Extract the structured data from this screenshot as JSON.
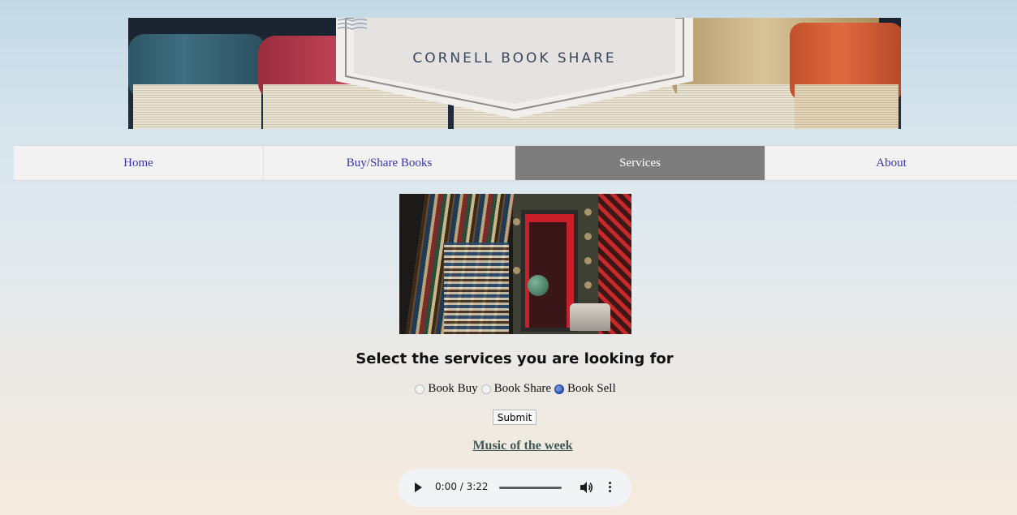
{
  "header": {
    "brand": "CORNELL BOOK SHARE"
  },
  "nav": {
    "items": [
      {
        "label": "Home",
        "active": false
      },
      {
        "label": "Buy/Share Books",
        "active": false
      },
      {
        "label": "Services",
        "active": true
      },
      {
        "label": "About",
        "active": false
      }
    ]
  },
  "services": {
    "heading": "Select the services you are looking for",
    "options": [
      {
        "label": "Book Buy",
        "checked": false
      },
      {
        "label": "Book Share",
        "checked": false
      },
      {
        "label": "Book Sell",
        "checked": true
      }
    ],
    "submit_label": "Submit"
  },
  "music": {
    "link_text": "Music of the week",
    "time_display": "0:00 / 3:22"
  },
  "colors": {
    "nav_active_bg": "#7d7d7d",
    "nav_link": "#3b36a8",
    "radio_checked": "#2c57b8"
  }
}
